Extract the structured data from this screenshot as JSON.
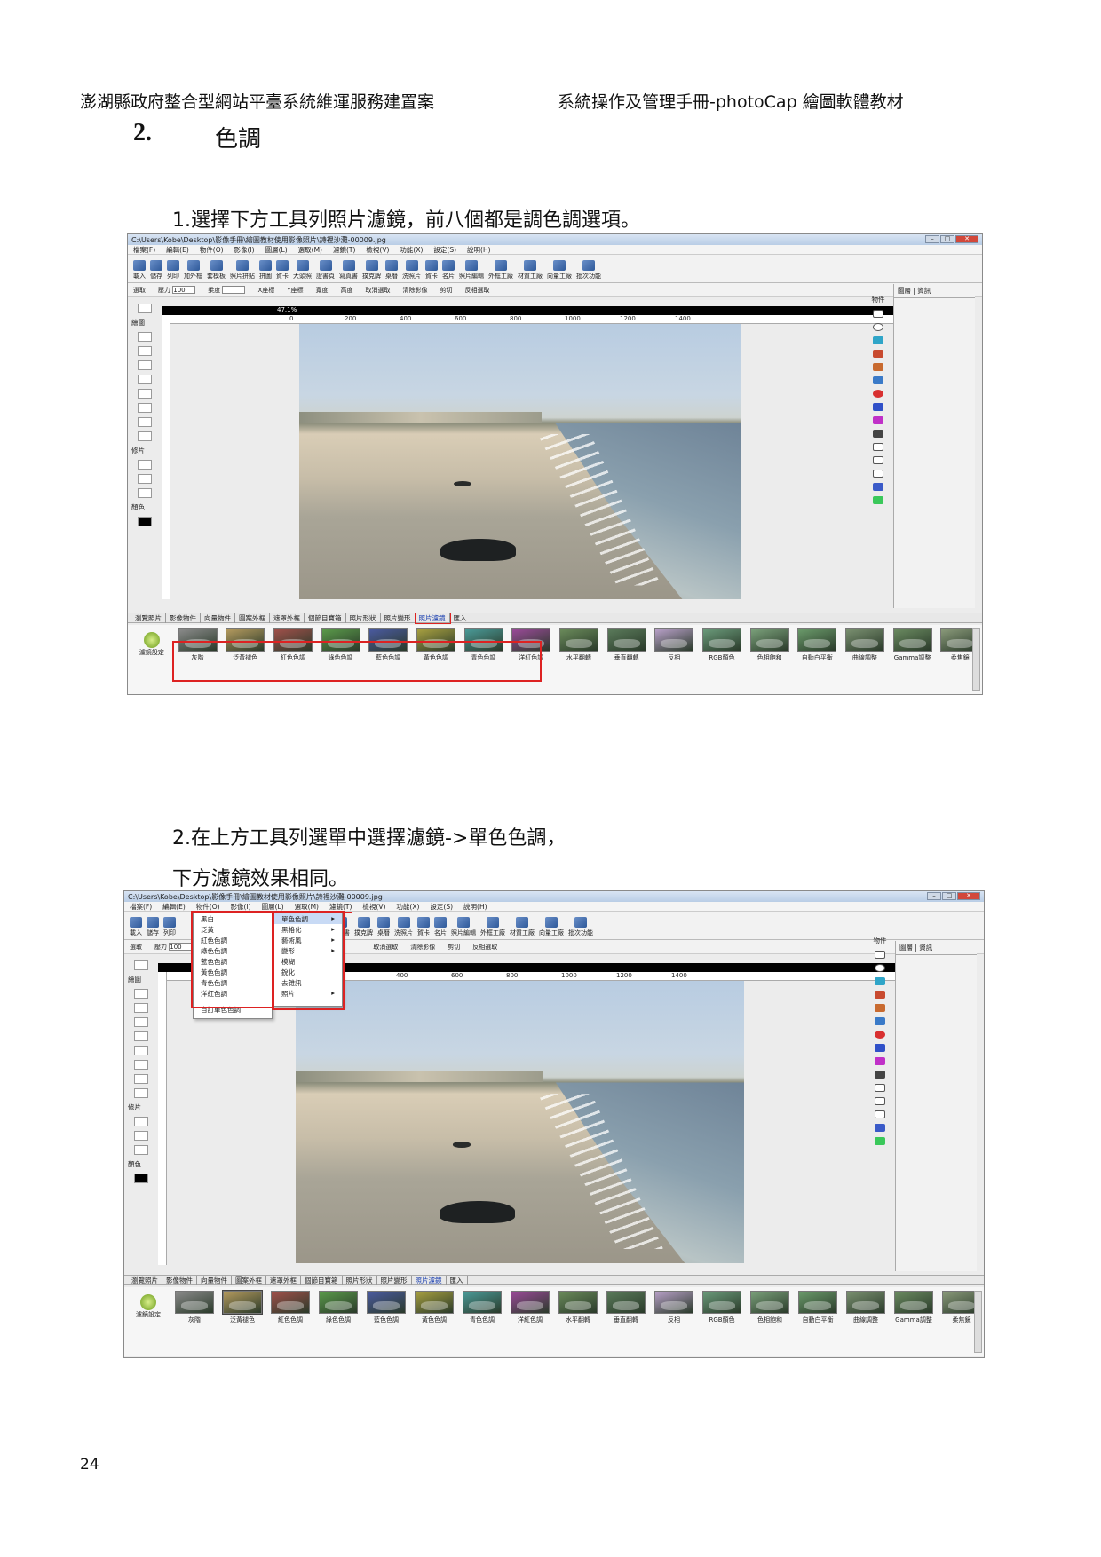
{
  "header": {
    "left": "澎湖縣政府整合型網站平臺系統維運服務建置案",
    "right": "系統操作及管理手冊-photoCap 繪圖軟體教材"
  },
  "section": {
    "number": "2.",
    "title": "色調"
  },
  "step1": "1.選擇下方工具列照片濾鏡，前八個都是調色調選項。",
  "step2": {
    "line1": "2.在上方工具列選單中選擇濾鏡->單色色調，",
    "line2": "下方濾鏡效果相同。"
  },
  "page_number": "24",
  "app": {
    "title": "C:\\Users\\Kobe\\Desktop\\影像手冊\\繪圖教材使用影像照片\\詩裡沙灘-00009.jpg",
    "menu": [
      "檔案(F)",
      "編輯(E)",
      "物件(O)",
      "影像(I)",
      "圖層(L)",
      "選取(M)",
      "濾鏡(T)",
      "檢視(V)",
      "功能(X)",
      "設定(S)",
      "說明(H)"
    ],
    "toolbar": [
      "載入",
      "儲存",
      "列印",
      "加外框",
      "套模板",
      "照片拼貼",
      "拼圖",
      "賀卡",
      "大頭照",
      "證書頁",
      "寫真書",
      "撲克牌",
      "桌曆",
      "洗照片",
      "賀卡",
      "名片",
      "照片編輯",
      "外框工廠",
      "材質工廠",
      "向量工廠",
      "批次功能"
    ],
    "options": {
      "select": "選取",
      "pressure": "壓力",
      "density": "柔度",
      "x": "X座標",
      "y": "Y座標",
      "width": "寬度",
      "height": "高度",
      "cancel": "取消選取",
      "clear": "清除影像",
      "cut": "剪切",
      "reverse": "反相選取",
      "value": "100"
    },
    "left_tools": {
      "draw": "繪圖",
      "repair": "修片",
      "color": "顏色"
    },
    "zoom": "47.1%",
    "ruler": [
      "0",
      "200",
      "400",
      "600",
      "800",
      "1000",
      "1200",
      "1400"
    ],
    "panel_tabs": {
      "objects": "物件",
      "layers": "圖層",
      "info": "資訊"
    },
    "bottom_tabs": [
      "瀏覽照片",
      "影像物件",
      "向量物件",
      "圖案外框",
      "遮罩外框",
      "個節目寶箱",
      "照片形狀",
      "照片變形",
      "照片濾鏡",
      "匯入"
    ],
    "filter_settings": "濾鏡設定",
    "filters": [
      {
        "name": "灰階",
        "color": "#8a8a8a"
      },
      {
        "name": "泛黃褪色",
        "color": "#b49a5e"
      },
      {
        "name": "紅色色調",
        "color": "#a0504a"
      },
      {
        "name": "綠色色調",
        "color": "#5a9a4a"
      },
      {
        "name": "藍色色調",
        "color": "#4a5aa0"
      },
      {
        "name": "黃色色調",
        "color": "#a8a040"
      },
      {
        "name": "青色色調",
        "color": "#4a9a98"
      },
      {
        "name": "洋紅色調",
        "color": "#9a4a98"
      },
      {
        "name": "水平翻轉",
        "color": "#6a8a5a"
      },
      {
        "name": "垂直翻轉",
        "color": "#5a7a5a"
      },
      {
        "name": "反相",
        "color": "#b8a0c8"
      },
      {
        "name": "RGB顏色",
        "color": "#6a9a7a"
      },
      {
        "name": "色相飽和",
        "color": "#7aa07a"
      },
      {
        "name": "自動白平衡",
        "color": "#6a9a6a"
      },
      {
        "name": "曲線調整",
        "color": "#7a9070"
      },
      {
        "name": "Gamma調整",
        "color": "#6a8a60"
      },
      {
        "name": "柔焦鏡",
        "color": "#8a9a7a"
      }
    ],
    "dropdown_main": [
      "單色色調",
      "黑格化",
      "藝術風",
      "變形",
      "模糊",
      "銳化",
      "去雜訊",
      "照片"
    ],
    "dropdown_sub": [
      "黑白",
      "泛黃",
      "紅色色調",
      "綠色色調",
      "藍色色調",
      "黃色色調",
      "青色色調",
      "洋紅色調",
      "自訂單色色調"
    ]
  }
}
